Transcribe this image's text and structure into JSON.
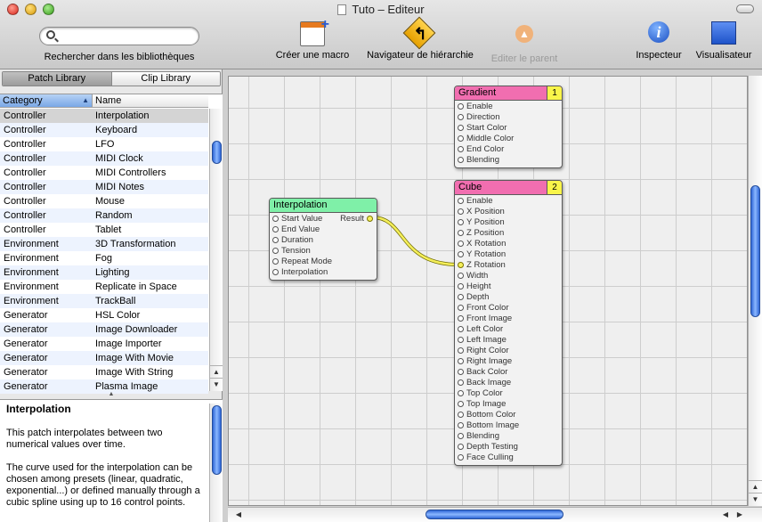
{
  "window": {
    "title": "Tuto – Editeur"
  },
  "toolbar": {
    "search_placeholder": "",
    "search_label": "Rechercher dans les bibliothèques",
    "create_macro": "Créer une macro",
    "hierarchy_navigator": "Navigateur de hiérarchie",
    "edit_parent": "Editer le parent",
    "inspector": "Inspecteur",
    "viewer": "Visualisateur"
  },
  "library": {
    "tabs": [
      "Patch Library",
      "Clip Library"
    ],
    "columns": [
      "Category",
      "Name"
    ],
    "rows": [
      [
        "Controller",
        "Interpolation"
      ],
      [
        "Controller",
        "Keyboard"
      ],
      [
        "Controller",
        "LFO"
      ],
      [
        "Controller",
        "MIDI Clock"
      ],
      [
        "Controller",
        "MIDI Controllers"
      ],
      [
        "Controller",
        "MIDI Notes"
      ],
      [
        "Controller",
        "Mouse"
      ],
      [
        "Controller",
        "Random"
      ],
      [
        "Controller",
        "Tablet"
      ],
      [
        "Environment",
        "3D Transformation"
      ],
      [
        "Environment",
        "Fog"
      ],
      [
        "Environment",
        "Lighting"
      ],
      [
        "Environment",
        "Replicate in Space"
      ],
      [
        "Environment",
        "TrackBall"
      ],
      [
        "Generator",
        "HSL Color"
      ],
      [
        "Generator",
        "Image Downloader"
      ],
      [
        "Generator",
        "Image Importer"
      ],
      [
        "Generator",
        "Image With Movie"
      ],
      [
        "Generator",
        "Image With String"
      ],
      [
        "Generator",
        "Plasma Image"
      ]
    ],
    "selected_row": 0
  },
  "description": {
    "title": "Interpolation",
    "p1": "This patch interpolates between two numerical values over time.",
    "p2": "The curve used for the interpolation can be chosen among presets (linear, quadratic, exponential...) or defined manually through a cubic spline using up to 16 control points."
  },
  "patches": {
    "gradient": {
      "title": "Gradient",
      "number": "1",
      "inputs": [
        "Enable",
        "Direction",
        "Start Color",
        "Middle Color",
        "End Color",
        "Blending"
      ]
    },
    "interpolation": {
      "title": "Interpolation",
      "inputs": [
        "Start Value",
        "End Value",
        "Duration",
        "Tension",
        "Repeat Mode",
        "Interpolation"
      ],
      "output": "Result"
    },
    "cube": {
      "title": "Cube",
      "number": "2",
      "inputs": [
        "Enable",
        "X Position",
        "Y Position",
        "Z Position",
        "X Rotation",
        "Y Rotation",
        "Z Rotation",
        "Width",
        "Height",
        "Depth",
        "Front Color",
        "Front Image",
        "Left Color",
        "Left Image",
        "Right Color",
        "Right Image",
        "Back Color",
        "Back Image",
        "Top Color",
        "Top Image",
        "Bottom Color",
        "Bottom Image",
        "Blending",
        "Depth Testing",
        "Face Culling"
      ],
      "connected_input": "Z Rotation"
    }
  },
  "colors": {
    "gradient_header": "#f16eb0",
    "cube_header": "#f16eb0",
    "interpolation_header": "#7ff0a8",
    "patch_number_bg": "#f9f54a",
    "connection": "#f5ef5a",
    "selection_accent": "#3875d7"
  }
}
